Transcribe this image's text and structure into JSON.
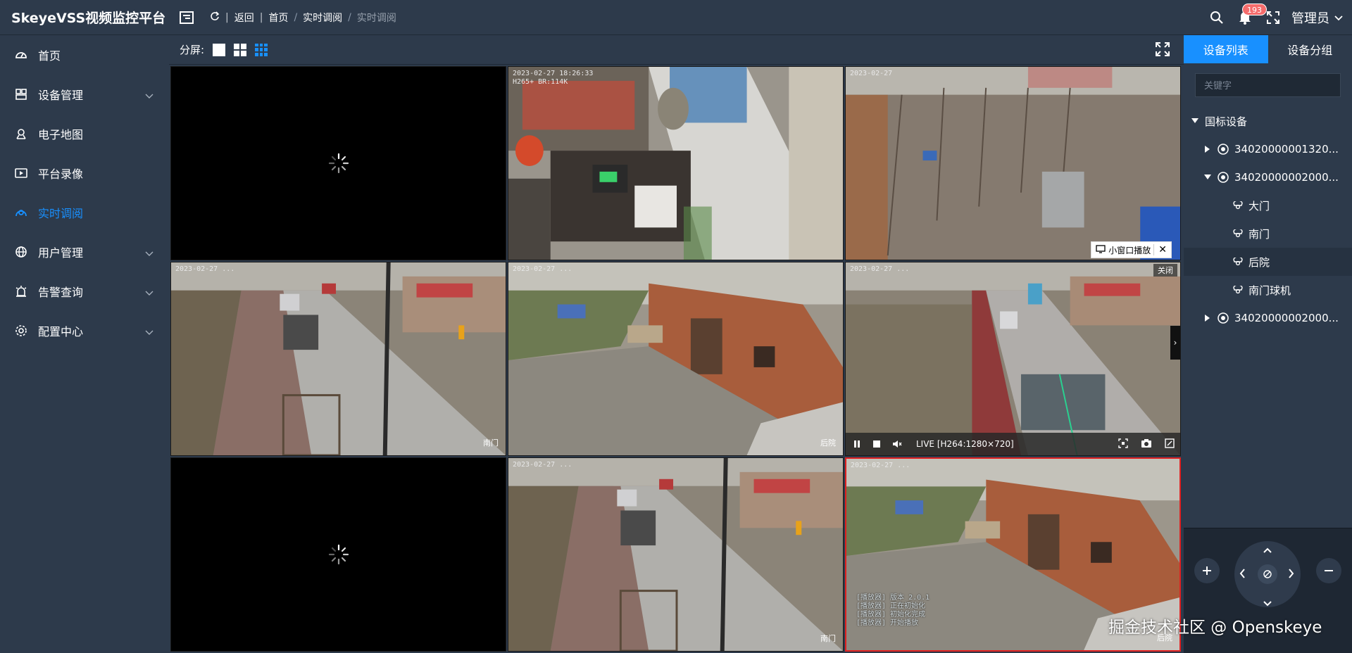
{
  "brand": "SkeyeVSS视频监控平台",
  "breadcrumb": {
    "back": "返回",
    "home": "首页",
    "parent": "实时调阅",
    "current": "实时调阅"
  },
  "notifications": {
    "count": "193"
  },
  "user": {
    "name": "管理员"
  },
  "sidebar": {
    "items": [
      {
        "label": "首页",
        "icon": "dashboard-icon"
      },
      {
        "label": "设备管理",
        "icon": "device-icon",
        "expandable": true
      },
      {
        "label": "电子地图",
        "icon": "map-icon"
      },
      {
        "label": "平台录像",
        "icon": "record-icon"
      },
      {
        "label": "实时调阅",
        "icon": "live-icon",
        "active": true
      },
      {
        "label": "用户管理",
        "icon": "globe-icon",
        "expandable": true
      },
      {
        "label": "告警查询",
        "icon": "alarm-icon",
        "expandable": true
      },
      {
        "label": "配置中心",
        "icon": "gear-icon",
        "expandable": true
      }
    ]
  },
  "split": {
    "label": "分屏:"
  },
  "cells": [
    {
      "state": "loading"
    },
    {
      "state": "playing",
      "osd": "2023-02-27 18:26:33\nH265+ BR:114K",
      "scene": "store",
      "name": ""
    },
    {
      "state": "playing",
      "osd": "2023-02-27",
      "scene": "yard",
      "name": "",
      "mini": true
    },
    {
      "state": "playing",
      "osd": "2023-02-27 ...",
      "scene": "street",
      "name": "南门"
    },
    {
      "state": "playing",
      "osd": "2023-02-27 ...",
      "scene": "house",
      "name": "后院"
    },
    {
      "state": "playing",
      "osd": "2023-02-27 ...",
      "scene": "street2",
      "name": "",
      "controls": true
    },
    {
      "state": "loading"
    },
    {
      "state": "playing",
      "osd": "2023-02-27 ...",
      "scene": "street",
      "name": "南门"
    },
    {
      "state": "playing",
      "osd": "2023-02-27 ...",
      "scene": "house",
      "name": "后院",
      "selected": true,
      "log": true
    }
  ],
  "mini_window": {
    "label": "小窗口播放"
  },
  "close_tag": "关闭",
  "player_controls": {
    "live": "LIVE [H264:1280×720]"
  },
  "player_log": [
    "[播放器] 版本 2.0.1",
    "[播放器] 正在初始化",
    "[播放器] 初始化完成",
    "[播放器] 开始播放"
  ],
  "right_panel": {
    "tabs": [
      "设备列表",
      "设备分组"
    ],
    "search_placeholder": "关键字",
    "tree": {
      "root": "国标设备",
      "nodes": [
        {
          "label": "34020000001320...",
          "expanded": false
        },
        {
          "label": "34020000002000...",
          "expanded": true,
          "children": [
            "大门",
            "南门",
            "后院",
            "南门球机"
          ]
        },
        {
          "label": "34020000002000...",
          "expanded": false
        }
      ]
    }
  },
  "watermark": "掘金技术社区 @ Openskeye",
  "colors": {
    "accent": "#1890ff",
    "bg": "#2d3a4b",
    "selected_border": "#e02020"
  }
}
